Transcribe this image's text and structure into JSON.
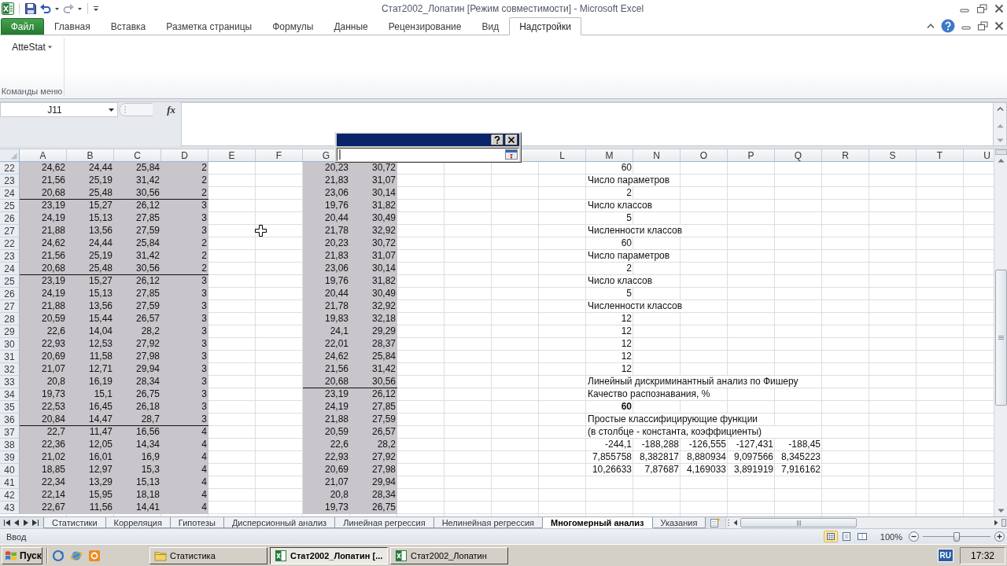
{
  "title_bar": {
    "quick_access": {
      "undo": {
        "disabled": false
      },
      "redo": {
        "disabled": true
      }
    },
    "title": "Стат2002_Лопатин [Режим совместимости] - Microsoft Excel"
  },
  "ribbon": {
    "file_tab": "Файл",
    "tabs": [
      {
        "label": "Главная",
        "selected": false
      },
      {
        "label": "Вставка",
        "selected": false
      },
      {
        "label": "Разметка страницы",
        "selected": false
      },
      {
        "label": "Формулы",
        "selected": false
      },
      {
        "label": "Данные",
        "selected": false
      },
      {
        "label": "Рецензирование",
        "selected": false
      },
      {
        "label": "Вид",
        "selected": false
      },
      {
        "label": "Надстройки",
        "selected": true
      }
    ],
    "groups": [
      {
        "label": "Команды меню",
        "commands": [
          {
            "label": "AtteStat"
          }
        ]
      }
    ]
  },
  "formula_bar": {
    "name_box": "J11",
    "insert_function": "fx"
  },
  "dialog": {
    "field_focused": true
  },
  "sheet": {
    "column_headers": [
      "A",
      "B",
      "C",
      "D",
      "E",
      "F",
      "G",
      "L",
      "M",
      "N",
      "O",
      "P",
      "Q",
      "R",
      "S",
      "T",
      "U"
    ],
    "data_ranges": [
      {
        "shaded": true
      },
      {
        "shaded": true
      }
    ],
    "rows": [
      {
        "header": "22",
        "ranges": [
          {
            "values": [
              "24,62",
              "24,44",
              "25,84",
              "2"
            ],
            "rule_below": false
          },
          {
            "values": [
              "20,23",
              "30,72"
            ],
            "rule_below": false
          }
        ],
        "results": [
          {
            "kind": "number",
            "text": "60",
            "bold": false
          }
        ]
      },
      {
        "header": "23",
        "ranges": [
          {
            "values": [
              "21,56",
              "25,19",
              "31,42",
              "2"
            ],
            "rule_below": false
          },
          {
            "values": [
              "21,83",
              "31,07"
            ],
            "rule_below": false
          }
        ],
        "results": [
          {
            "kind": "text",
            "text": "Число параметров",
            "bold": false
          }
        ]
      },
      {
        "header": "24",
        "ranges": [
          {
            "values": [
              "20,68",
              "25,48",
              "30,56",
              "2"
            ],
            "rule_below": true
          },
          {
            "values": [
              "23,06",
              "30,14"
            ],
            "rule_below": false
          }
        ],
        "results": [
          {
            "kind": "number",
            "text": "2",
            "bold": false
          }
        ]
      },
      {
        "header": "25",
        "ranges": [
          {
            "values": [
              "23,19",
              "15,27",
              "26,12",
              "3"
            ],
            "rule_below": false
          },
          {
            "values": [
              "19,76",
              "31,82"
            ],
            "rule_below": false
          }
        ],
        "results": [
          {
            "kind": "text",
            "text": "Число классов",
            "bold": false
          }
        ]
      },
      {
        "header": "26",
        "ranges": [
          {
            "values": [
              "24,19",
              "15,13",
              "27,85",
              "3"
            ],
            "rule_below": false
          },
          {
            "values": [
              "20,44",
              "30,49"
            ],
            "rule_below": false
          }
        ],
        "results": [
          {
            "kind": "number",
            "text": "5",
            "bold": false
          }
        ]
      },
      {
        "header": "27",
        "ranges": [
          {
            "values": [
              "21,88",
              "13,56",
              "27,59",
              "3"
            ],
            "rule_below": false
          },
          {
            "values": [
              "21,78",
              "32,92"
            ],
            "rule_below": false
          }
        ],
        "results": [
          {
            "kind": "text",
            "text": "Численности классов",
            "bold": false
          }
        ]
      },
      {
        "header": "22",
        "ranges": [
          {
            "values": [
              "24,62",
              "24,44",
              "25,84",
              "2"
            ],
            "rule_below": false
          },
          {
            "values": [
              "20,23",
              "30,72"
            ],
            "rule_below": false
          }
        ],
        "results": [
          {
            "kind": "number",
            "text": "60",
            "bold": false
          }
        ]
      },
      {
        "header": "23",
        "ranges": [
          {
            "values": [
              "21,56",
              "25,19",
              "31,42",
              "2"
            ],
            "rule_below": false
          },
          {
            "values": [
              "21,83",
              "31,07"
            ],
            "rule_below": false
          }
        ],
        "results": [
          {
            "kind": "text",
            "text": "Число параметров",
            "bold": false
          }
        ]
      },
      {
        "header": "24",
        "ranges": [
          {
            "values": [
              "20,68",
              "25,48",
              "30,56",
              "2"
            ],
            "rule_below": true
          },
          {
            "values": [
              "23,06",
              "30,14"
            ],
            "rule_below": false
          }
        ],
        "results": [
          {
            "kind": "number",
            "text": "2",
            "bold": false
          }
        ]
      },
      {
        "header": "25",
        "ranges": [
          {
            "values": [
              "23,19",
              "15,27",
              "26,12",
              "3"
            ],
            "rule_below": false
          },
          {
            "values": [
              "19,76",
              "31,82"
            ],
            "rule_below": false
          }
        ],
        "results": [
          {
            "kind": "text",
            "text": "Число классов",
            "bold": false
          }
        ]
      },
      {
        "header": "26",
        "ranges": [
          {
            "values": [
              "24,19",
              "15,13",
              "27,85",
              "3"
            ],
            "rule_below": false
          },
          {
            "values": [
              "20,44",
              "30,49"
            ],
            "rule_below": false
          }
        ],
        "results": [
          {
            "kind": "number",
            "text": "5",
            "bold": false
          }
        ]
      },
      {
        "header": "27",
        "ranges": [
          {
            "values": [
              "21,88",
              "13,56",
              "27,59",
              "3"
            ],
            "rule_below": false
          },
          {
            "values": [
              "21,78",
              "32,92"
            ],
            "rule_below": false
          }
        ],
        "results": [
          {
            "kind": "text",
            "text": "Численности классов",
            "bold": false
          }
        ]
      },
      {
        "header": "28",
        "ranges": [
          {
            "values": [
              "20,59",
              "15,44",
              "26,57",
              "3"
            ],
            "rule_below": false
          },
          {
            "values": [
              "19,83",
              "32,18"
            ],
            "rule_below": false
          }
        ],
        "results": [
          {
            "kind": "number",
            "text": "12",
            "bold": false
          }
        ]
      },
      {
        "header": "29",
        "ranges": [
          {
            "values": [
              "22,6",
              "14,04",
              "28,2",
              "3"
            ],
            "rule_below": false
          },
          {
            "values": [
              "24,1",
              "29,29"
            ],
            "rule_below": false
          }
        ],
        "results": [
          {
            "kind": "number",
            "text": "12",
            "bold": false
          }
        ]
      },
      {
        "header": "30",
        "ranges": [
          {
            "values": [
              "22,93",
              "12,53",
              "27,92",
              "3"
            ],
            "rule_below": false
          },
          {
            "values": [
              "22,01",
              "28,37"
            ],
            "rule_below": false
          }
        ],
        "results": [
          {
            "kind": "number",
            "text": "12",
            "bold": false
          }
        ]
      },
      {
        "header": "31",
        "ranges": [
          {
            "values": [
              "20,69",
              "11,58",
              "27,98",
              "3"
            ],
            "rule_below": false
          },
          {
            "values": [
              "24,62",
              "25,84"
            ],
            "rule_below": false
          }
        ],
        "results": [
          {
            "kind": "number",
            "text": "12",
            "bold": false
          }
        ]
      },
      {
        "header": "32",
        "ranges": [
          {
            "values": [
              "21,07",
              "12,71",
              "29,94",
              "3"
            ],
            "rule_below": false
          },
          {
            "values": [
              "21,56",
              "31,42"
            ],
            "rule_below": false
          }
        ],
        "results": [
          {
            "kind": "number",
            "text": "12",
            "bold": false
          }
        ]
      },
      {
        "header": "33",
        "ranges": [
          {
            "values": [
              "20,8",
              "16,19",
              "28,34",
              "3"
            ],
            "rule_below": false
          },
          {
            "values": [
              "20,68",
              "30,56"
            ],
            "rule_below": true
          }
        ],
        "results": [
          {
            "kind": "text",
            "text": "Линейный дискриминантный анализ по Фишеру",
            "bold": false
          }
        ]
      },
      {
        "header": "34",
        "ranges": [
          {
            "values": [
              "19,73",
              "15,1",
              "26,75",
              "3"
            ],
            "rule_below": false
          },
          {
            "values": [
              "23,19",
              "26,12"
            ],
            "rule_below": false
          }
        ],
        "results": [
          {
            "kind": "text",
            "text": "Качество распознавания, %",
            "bold": false
          }
        ]
      },
      {
        "header": "35",
        "ranges": [
          {
            "values": [
              "22,53",
              "16,45",
              "26,18",
              "3"
            ],
            "rule_below": false
          },
          {
            "values": [
              "24,19",
              "27,85"
            ],
            "rule_below": false
          }
        ],
        "results": [
          {
            "kind": "number",
            "text": "60",
            "bold": true
          }
        ]
      },
      {
        "header": "36",
        "ranges": [
          {
            "values": [
              "20,84",
              "14,47",
              "28,7",
              "3"
            ],
            "rule_below": true
          },
          {
            "values": [
              "21,88",
              "27,59"
            ],
            "rule_below": false
          }
        ],
        "results": [
          {
            "kind": "text",
            "text": "Простые классифицирующие функции",
            "bold": false
          }
        ]
      },
      {
        "header": "37",
        "ranges": [
          {
            "values": [
              "22,7",
              "11,47",
              "16,56",
              "4"
            ],
            "rule_below": false
          },
          {
            "values": [
              "20,59",
              "26,57"
            ],
            "rule_below": false
          }
        ],
        "results": [
          {
            "kind": "text",
            "text": "(в столбце - константа, коэффициенты)",
            "bold": false
          }
        ]
      },
      {
        "header": "38",
        "ranges": [
          {
            "values": [
              "22,36",
              "12,05",
              "14,34",
              "4"
            ],
            "rule_below": false
          },
          {
            "values": [
              "22,6",
              "28,2"
            ],
            "rule_below": false
          }
        ],
        "results": [
          {
            "kind": "number",
            "text": "-244,1",
            "bold": false
          },
          {
            "kind": "number",
            "text": "-188,288",
            "bold": false
          },
          {
            "kind": "number",
            "text": "-126,555",
            "bold": false
          },
          {
            "kind": "number",
            "text": "-127,431",
            "bold": false
          },
          {
            "kind": "number",
            "text": "-188,45",
            "bold": false
          }
        ]
      },
      {
        "header": "39",
        "ranges": [
          {
            "values": [
              "21,02",
              "16,01",
              "16,9",
              "4"
            ],
            "rule_below": false
          },
          {
            "values": [
              "22,93",
              "27,92"
            ],
            "rule_below": false
          }
        ],
        "results": [
          {
            "kind": "number",
            "text": "7,855758",
            "bold": false
          },
          {
            "kind": "number",
            "text": "8,382817",
            "bold": false
          },
          {
            "kind": "number",
            "text": "8,880934",
            "bold": false
          },
          {
            "kind": "number",
            "text": "9,097566",
            "bold": false
          },
          {
            "kind": "number",
            "text": "8,345223",
            "bold": false
          }
        ]
      },
      {
        "header": "40",
        "ranges": [
          {
            "values": [
              "18,85",
              "12,97",
              "15,3",
              "4"
            ],
            "rule_below": false
          },
          {
            "values": [
              "20,69",
              "27,98"
            ],
            "rule_below": false
          }
        ],
        "results": [
          {
            "kind": "number",
            "text": "10,26633",
            "bold": false
          },
          {
            "kind": "number",
            "text": "7,87687",
            "bold": false
          },
          {
            "kind": "number",
            "text": "4,169033",
            "bold": false
          },
          {
            "kind": "number",
            "text": "3,891919",
            "bold": false
          },
          {
            "kind": "number",
            "text": "7,916162",
            "bold": false
          }
        ]
      },
      {
        "header": "41",
        "ranges": [
          {
            "values": [
              "22,34",
              "13,29",
              "15,13",
              "4"
            ],
            "rule_below": false
          },
          {
            "values": [
              "21,07",
              "29,94"
            ],
            "rule_below": false
          }
        ]
      },
      {
        "header": "42",
        "ranges": [
          {
            "values": [
              "22,14",
              "15,95",
              "18,18",
              "4"
            ],
            "rule_below": false
          },
          {
            "values": [
              "20,8",
              "28,34"
            ],
            "rule_below": false
          }
        ]
      },
      {
        "header": "43",
        "ranges": [
          {
            "values": [
              "22,67",
              "11,56",
              "14,41",
              "4"
            ],
            "rule_below": false
          },
          {
            "values": [
              "19,73",
              "26,75"
            ],
            "rule_below": false
          }
        ]
      }
    ]
  },
  "sheet_tabs": [
    {
      "label": "Статистики",
      "selected": false
    },
    {
      "label": "Корреляция",
      "selected": false
    },
    {
      "label": "Гипотезы",
      "selected": false
    },
    {
      "label": "Дисперсионный анализ",
      "selected": false
    },
    {
      "label": "Линейная регрессия",
      "selected": false
    },
    {
      "label": "Нелинейная регрессия",
      "selected": false
    },
    {
      "label": "Многомерный анализ",
      "selected": true
    },
    {
      "label": "Указания",
      "selected": false
    }
  ],
  "status_bar": {
    "mode": "Ввод",
    "views": [
      {
        "kind": "normal",
        "selected": true
      },
      {
        "kind": "page_layout",
        "selected": false
      },
      {
        "kind": "page_break",
        "selected": false
      }
    ],
    "zoom": "100%",
    "zoom_slider": {
      "level": 0.5
    }
  },
  "taskbar": {
    "start": "Пуск",
    "windows": [
      {
        "label": "Статистика",
        "kind": "folder",
        "selected": false
      },
      {
        "label": "Стат2002_Лопатин [...",
        "kind": "spreadsheet",
        "selected": true
      },
      {
        "label": "Стат2002_Лопатин",
        "kind": "spreadsheet",
        "selected": false
      }
    ],
    "language": "RU",
    "clock": "17:32"
  }
}
